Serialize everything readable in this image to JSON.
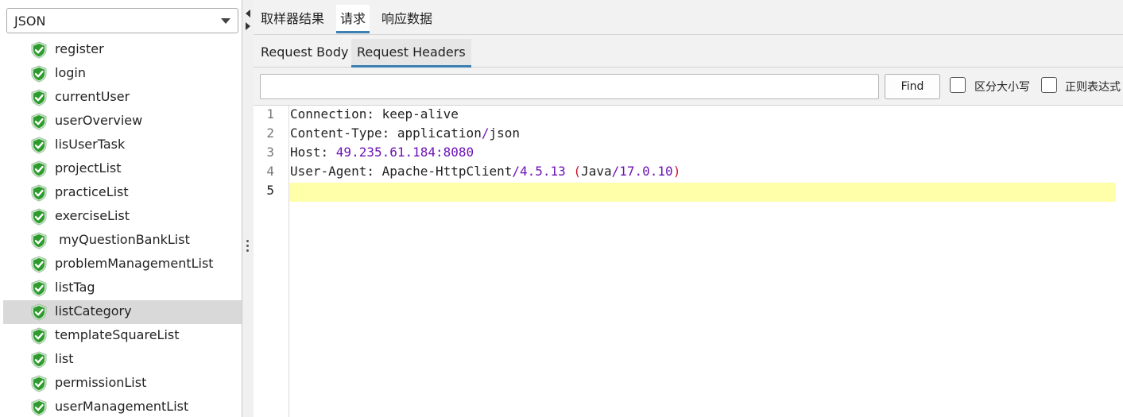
{
  "left": {
    "combo_value": "JSON",
    "items": [
      {
        "label": "register"
      },
      {
        "label": "login"
      },
      {
        "label": "currentUser"
      },
      {
        "label": "userOverview"
      },
      {
        "label": "lisUserTask"
      },
      {
        "label": "projectList"
      },
      {
        "label": "practiceList"
      },
      {
        "label": "exerciseList"
      },
      {
        "label": " myQuestionBankList"
      },
      {
        "label": "problemManagementList"
      },
      {
        "label": "listTag"
      },
      {
        "label": "listCategory",
        "selected": true
      },
      {
        "label": "templateSquareList"
      },
      {
        "label": "list"
      },
      {
        "label": "permissionList"
      },
      {
        "label": "userManagementList"
      }
    ],
    "status_icon": "green-check-shield-icon",
    "status_color": "#2e9b2e"
  },
  "tabs_top": {
    "tab0": "取样器结果",
    "tab1": "请求",
    "tab2": "响应数据",
    "active": "请求"
  },
  "tabs_sub": {
    "tab0": "Request Body",
    "tab1": "Request Headers",
    "active": "Request Headers"
  },
  "search": {
    "value": "",
    "find_label": "Find",
    "case_label": "区分大小写",
    "regex_label": "正则表达式"
  },
  "editor": {
    "line_numbers": [
      "1",
      "2",
      "3",
      "4",
      "5"
    ],
    "current_line": "5",
    "lines": [
      {
        "key": "Connection",
        "sep": ": ",
        "value": "keep-alive"
      },
      {
        "key": "Content-Type",
        "sep": ": ",
        "value": "application",
        "slash": "/",
        "value2": "json"
      },
      {
        "key": "Host",
        "sep": ": ",
        "value": "49.235.61.184:8080"
      },
      {
        "key": "User-Agent",
        "sep": ": ",
        "value": "Apache-HttpClient",
        "slash": "/",
        "version": "4.5.13",
        "space": " ",
        "lparen": "(",
        "java": "Java",
        "slash2": "/",
        "java_version": "17.0.10",
        "rparen": ")"
      }
    ]
  }
}
